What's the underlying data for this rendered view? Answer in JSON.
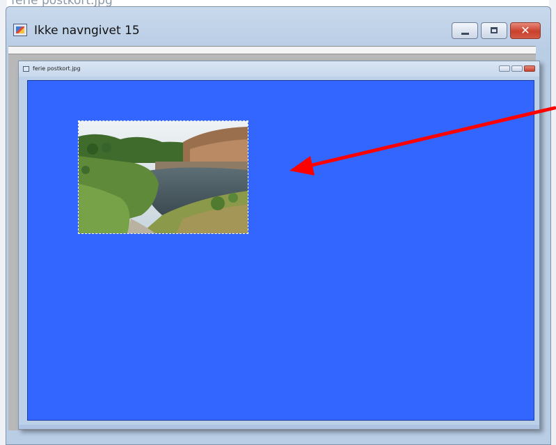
{
  "background": {
    "title": "ferie postkort.jpg"
  },
  "outer_window": {
    "title": "Ikke navngivet 15",
    "icon": "paint-shop-image-icon",
    "buttons": {
      "minimize": "minimize",
      "maximize": "maximize",
      "close": "✕"
    }
  },
  "document_window": {
    "title": "ferie postkort.jpg",
    "icon": "image-document-icon",
    "canvas_color": "#3366ff",
    "photo_description_icon": "landscape-photo"
  },
  "annotation": {
    "arrow_color": "#ff0000"
  }
}
